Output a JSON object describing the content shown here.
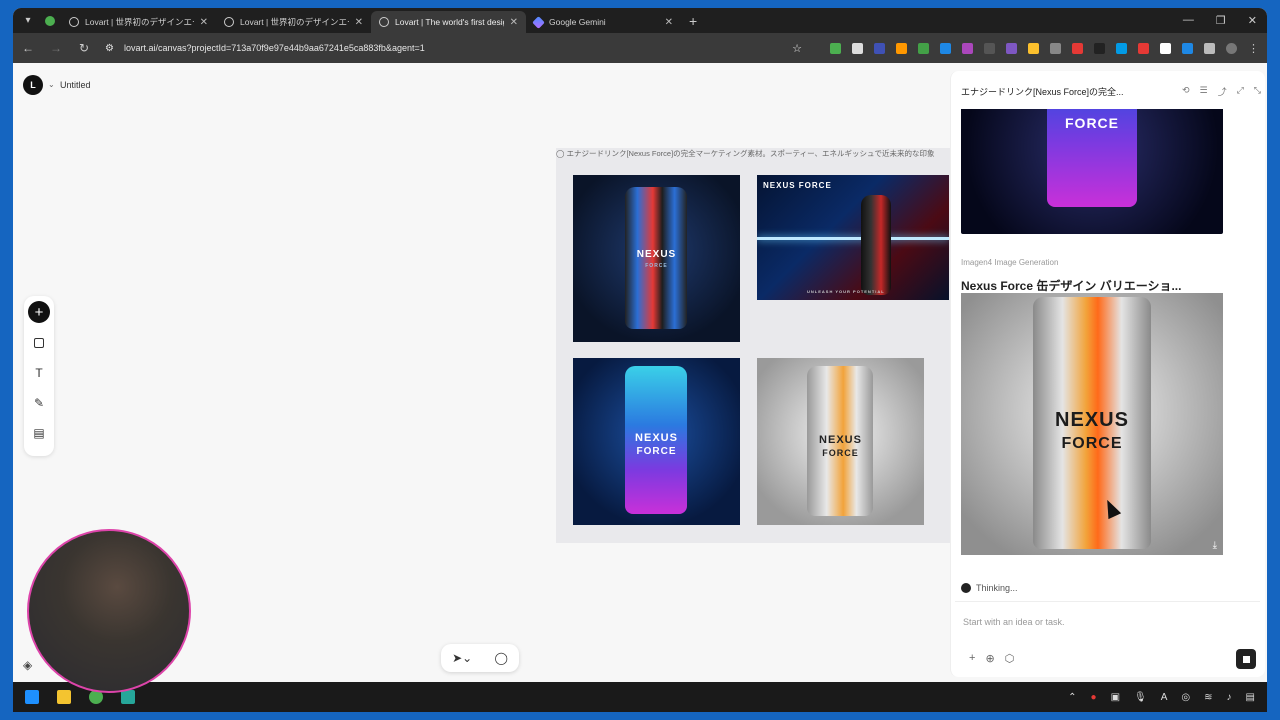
{
  "browser": {
    "tabs": [
      {
        "title": "Lovart | 世界初のデザインエージェント",
        "active": false
      },
      {
        "title": "Lovart | 世界初のデザインエージェント",
        "active": false
      },
      {
        "title": "Lovart | The world's first design agent",
        "active": true
      },
      {
        "title": "Google Gemini",
        "active": false
      }
    ],
    "url": "lovart.ai/canvas?projectId=713a70f9e97e44b9aa67241e5ca883fb&agent=1"
  },
  "app": {
    "doc_title": "Untitled",
    "frame_label": "◯ エナジードリンク[Nexus Force]の完全マーケティング素材。スポーティー、エネルギッシュで近未来的な印象",
    "images": [
      {
        "name": "NEXUS",
        "sub": "FORCE"
      },
      {
        "name": "NEXUS FORCE",
        "tagline": "UNLEASH YOUR POTENTIAL"
      },
      {
        "name": "NEXUS",
        "sub": "FORCE"
      },
      {
        "name": "NEXUS",
        "sub": "FORCE"
      }
    ]
  },
  "panel": {
    "title": "エナジードリンク[Nexus Force]の完全...",
    "top_image_text": "FORCE",
    "gen_label": "Imagen4 Image Generation",
    "gen_title": "Nexus Force 缶デザイン バリエーショ...",
    "main_image_name": "NEXUS",
    "main_image_sub": "FORCE",
    "thinking": "Thinking...",
    "input_placeholder": "Start with an idea or task."
  },
  "colors": {
    "accent": "#111111",
    "canvas_bg": "#f7f7f7",
    "browser_dark": "#1f1f1f",
    "taskbar_bg": "#1a1a1a"
  }
}
